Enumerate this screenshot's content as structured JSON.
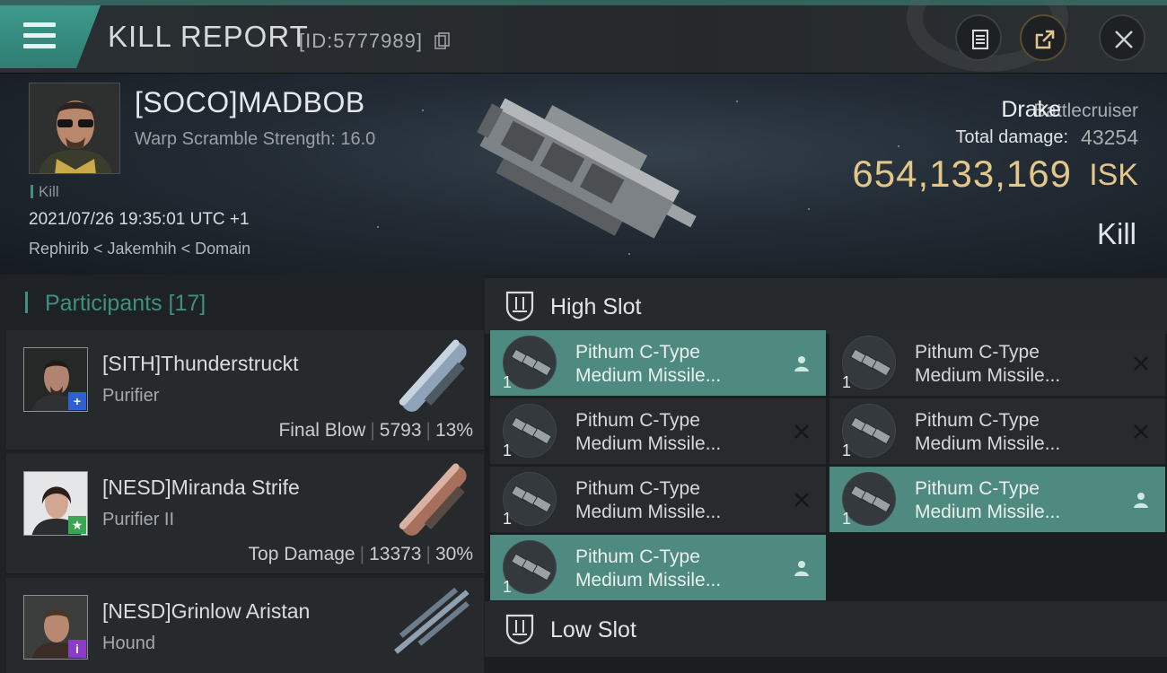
{
  "header": {
    "title": "KILL REPORT",
    "report_id": "[ID:5777989]",
    "icons": [
      "menu-icon",
      "copy-icon",
      "clipboard-icon",
      "share-icon",
      "close-icon"
    ]
  },
  "victim": {
    "name": "[SOCO]MADBOB",
    "warp_scramble": "Warp Scramble Strength: 16.0",
    "tag": "Kill",
    "datetime": "2021/07/26 19:35:01 UTC +1",
    "location": "Rephirib < Jakemhih < Domain"
  },
  "ship": {
    "name": "Drake",
    "class": "Battlecruiser",
    "total_damage_label": "Total damage:",
    "total_damage": "43254",
    "isk_value": "654,133,169",
    "isk_unit": "ISK",
    "result": "Kill"
  },
  "participants": {
    "label": "Participants",
    "count": "[17]",
    "items": [
      {
        "name": "[SITH]Thunderstruckt",
        "ship": "Purifier",
        "role": "Final Blow",
        "damage": "5793",
        "percent": "13%",
        "badge": "+",
        "badge_color": "#2f5fd0"
      },
      {
        "name": "[NESD]Miranda Strife",
        "ship": "Purifier II",
        "role": "Top Damage",
        "damage": "13373",
        "percent": "30%",
        "badge": "★",
        "badge_color": "#3aa653"
      },
      {
        "name": "[NESD]Grinlow Aristan",
        "ship": "Hound",
        "role": "",
        "damage": "",
        "percent": "",
        "badge": "i",
        "badge_color": "#8a3cc8"
      }
    ]
  },
  "slots": {
    "high_label": "High Slot",
    "low_label": "Low Slot",
    "modules": [
      {
        "line1": "Pithum C-Type",
        "line2": "Medium Missile...",
        "qty": "1",
        "state": "fitted"
      },
      {
        "line1": "Pithum C-Type",
        "line2": "Medium Missile...",
        "qty": "1",
        "state": "destroyed"
      },
      {
        "line1": "Pithum C-Type",
        "line2": "Medium Missile...",
        "qty": "1",
        "state": "destroyed"
      },
      {
        "line1": "Pithum C-Type",
        "line2": "Medium Missile...",
        "qty": "1",
        "state": "destroyed"
      },
      {
        "line1": "Pithum C-Type",
        "line2": "Medium Missile...",
        "qty": "1",
        "state": "destroyed"
      },
      {
        "line1": "Pithum C-Type",
        "line2": "Medium Missile...",
        "qty": "1",
        "state": "fitted"
      },
      {
        "line1": "Pithum C-Type",
        "line2": "Medium Missile...",
        "qty": "1",
        "state": "fitted"
      }
    ],
    "colors": {
      "fitted": "#4f8a80",
      "destroyed": "#272b2e"
    }
  }
}
